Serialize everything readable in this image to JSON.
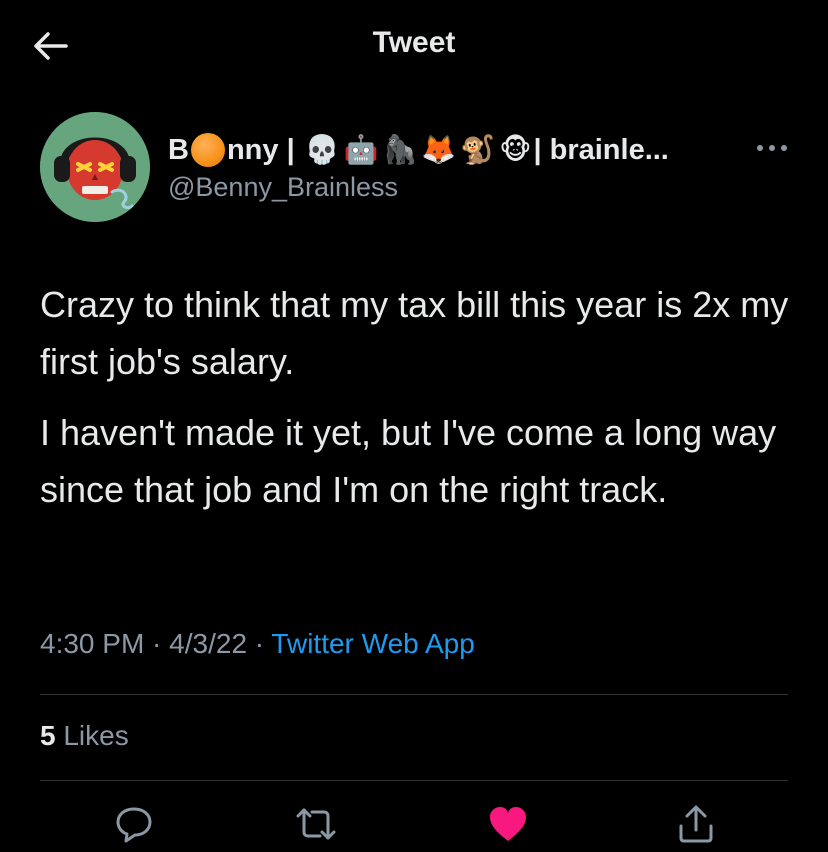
{
  "header": {
    "title": "Tweet",
    "back_icon": "arrow-left-icon"
  },
  "author": {
    "name_prefix": "B",
    "name_mid": "nny |",
    "name_suffix": "| brainle...",
    "emojis": [
      "orange-circle",
      "skull",
      "robot",
      "gorilla",
      "fox",
      "monkey",
      "monkey-face"
    ],
    "handle": "@Benny_Brainless"
  },
  "tweet": {
    "paragraphs": [
      "Crazy to think that my tax bill this year is 2x my first job's salary.",
      "I haven't made it yet, but I've come a long way since that job and I'm on the right track."
    ]
  },
  "meta": {
    "time": "4:30 PM",
    "separator": " · ",
    "date": "4/3/22",
    "source": "Twitter Web App"
  },
  "stats": {
    "likes_count": "5",
    "likes_label": " Likes"
  },
  "actions": {
    "reply_icon": "reply-icon",
    "retweet_icon": "retweet-icon",
    "like_icon": "heart-icon",
    "share_icon": "share-icon"
  },
  "colors": {
    "background": "#000000",
    "text": "#e7e9ea",
    "muted": "#8b98a5",
    "link": "#1d9bf0",
    "like": "#f91880",
    "divider": "#2f3336"
  }
}
